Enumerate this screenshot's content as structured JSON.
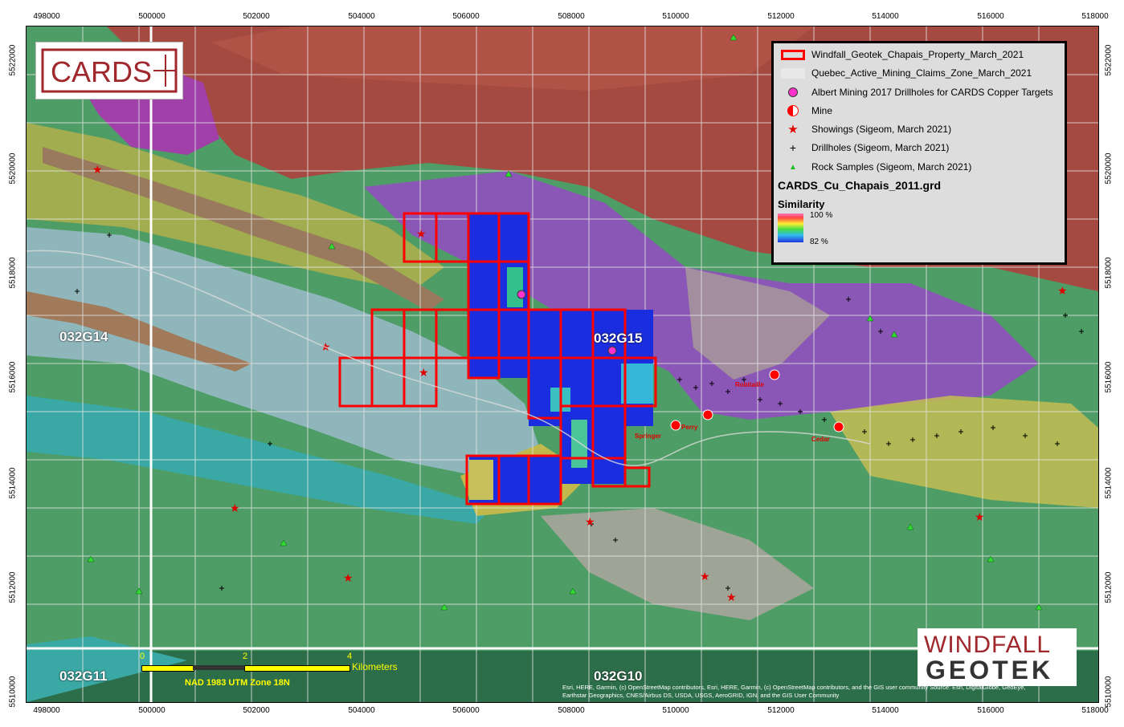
{
  "axes": {
    "x_ticks": [
      "498000",
      "500000",
      "502000",
      "504000",
      "506000",
      "508000",
      "510000",
      "512000",
      "514000",
      "516000",
      "518000"
    ],
    "y_ticks": [
      "5522000",
      "5520000",
      "5518000",
      "5516000",
      "5514000",
      "5512000",
      "5510000"
    ]
  },
  "sheets": [
    "032G14",
    "032G15",
    "032G11",
    "032G10"
  ],
  "towns": [
    "Robitaille",
    "Perry",
    "Springer",
    "Cedar"
  ],
  "legend": {
    "items": [
      {
        "label": "Windfall_Geotek_Chapais_Property_March_2021",
        "icon": "property-outline-icon"
      },
      {
        "label": "Quebec_Active_Mining_Claims_Zone_March_2021",
        "icon": "claims-zone-icon"
      },
      {
        "label": "Albert Mining 2017 Drillholes for CARDS Copper Targets",
        "icon": "target-circle-icon"
      },
      {
        "label": "Mine",
        "icon": "mine-icon"
      },
      {
        "label": "Showings (Sigeom, March 2021)",
        "icon": "star-icon"
      },
      {
        "label": "Drillholes (Sigeom, March 2021)",
        "icon": "cross-icon"
      },
      {
        "label": "Rock Samples (Sigeom, March 2021)",
        "icon": "triangle-icon"
      }
    ],
    "grid_title": "CARDS_Cu_Chapais_2011.grd",
    "similarity_title": "Similarity",
    "similarity_max": "100 %",
    "similarity_min": "82 %"
  },
  "logos": {
    "cards": "CARDS",
    "windfall_line1": "WINDFALL",
    "windfall_line2": "GEOTEK"
  },
  "scalebar": {
    "labels": [
      "0",
      "2",
      "4"
    ],
    "unit": "Kilometers",
    "projection": "NAD 1983 UTM Zone 18N"
  },
  "attribution": "Esri, HERE, Garmin, (c) OpenStreetMap contributors, Esri, HERE, Garmin, (c) OpenStreetMap contributors, and the GIS user community Source: Esri, DigitalGlobe, GeoEye, Earthstar Geographics, CNES/Airbus DS, USDA, USGS, AeroGRID, IGN, and the GIS User Community",
  "colors": {
    "property_outline": "#ff0000",
    "similarity_low": "#1a2ee0",
    "geology_red": "#a24b3e",
    "geology_green": "#3f9a68",
    "geology_purple": "#8a55b5",
    "geology_yellow": "#b9b84a",
    "scalebar": "#ffff00"
  }
}
